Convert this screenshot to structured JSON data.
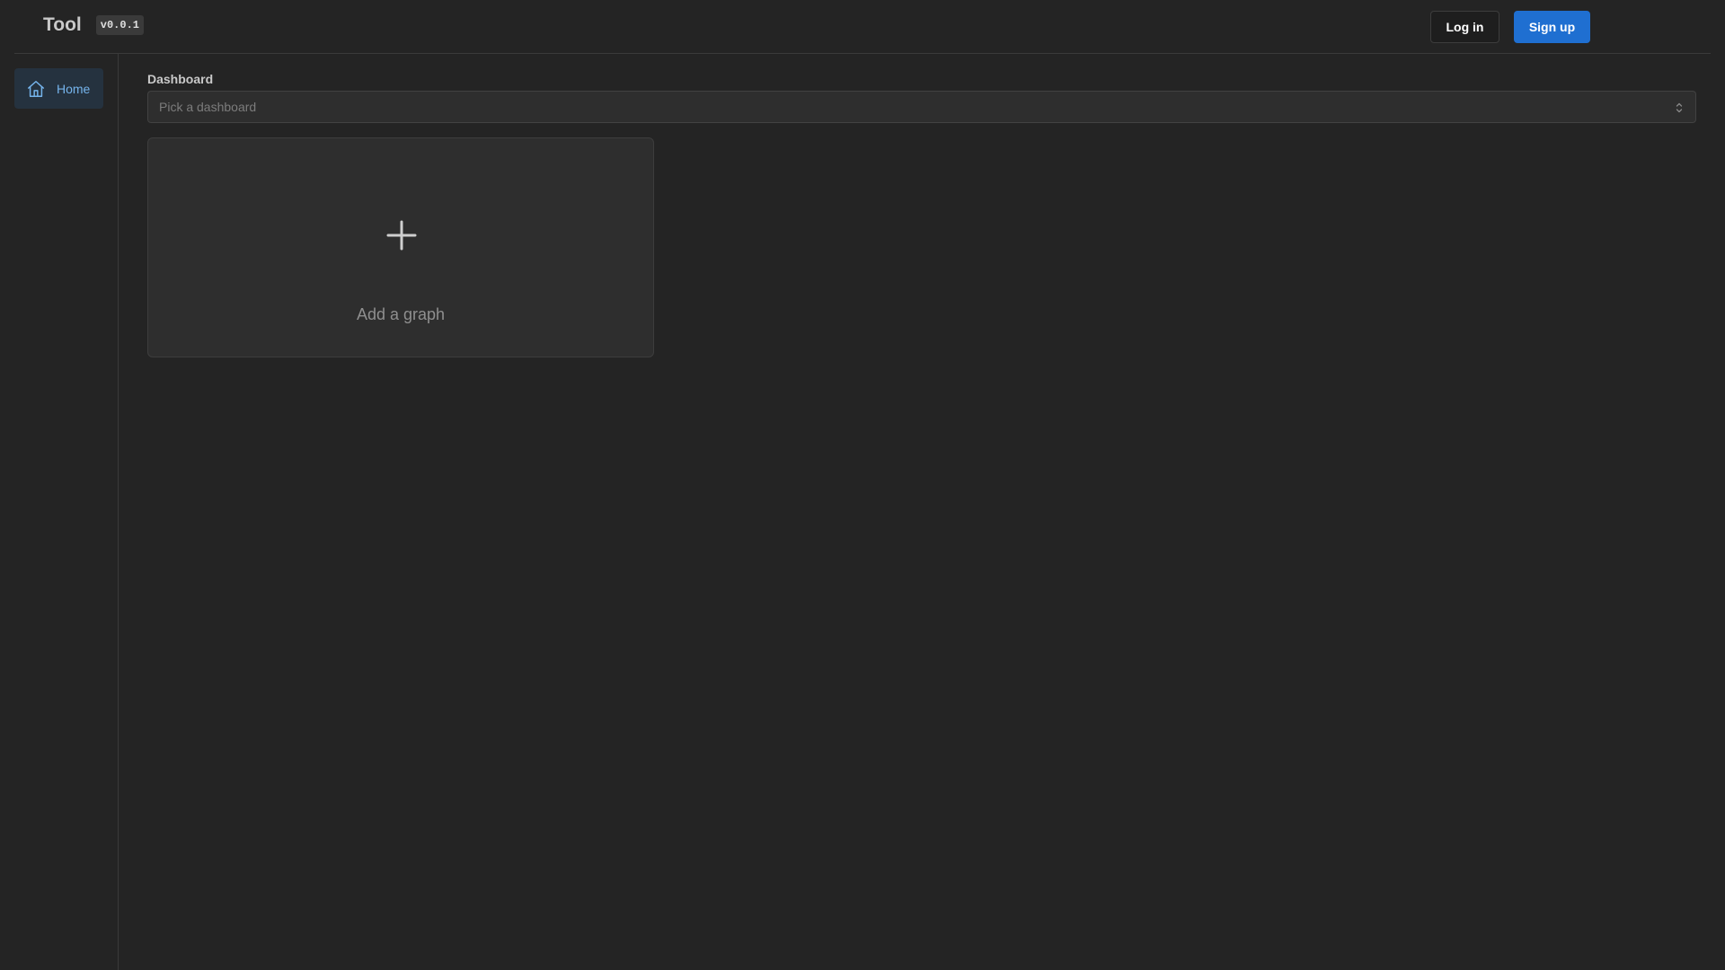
{
  "header": {
    "title": "Tool",
    "version": "v0.0.1",
    "login_label": "Log in",
    "signup_label": "Sign up"
  },
  "sidebar": {
    "items": [
      {
        "label": "Home",
        "icon": "home-icon",
        "active": true
      }
    ]
  },
  "main": {
    "dashboard_label": "Dashboard",
    "dashboard_select": {
      "placeholder": "Pick a dashboard",
      "value": ""
    },
    "add_card": {
      "label": "Add a graph",
      "icon": "plus-icon"
    }
  },
  "colors": {
    "background": "#242424",
    "accent": "#1f6fd1",
    "active_nav_bg": "#25323f",
    "active_nav_text": "#75b4ec"
  }
}
